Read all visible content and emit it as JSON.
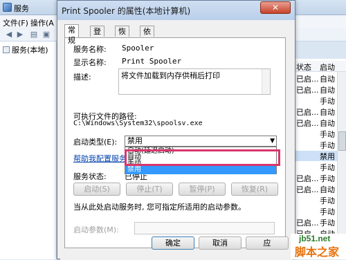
{
  "background_window": {
    "title": "服务",
    "menu": [
      "文件(F)",
      "操作(A"
    ],
    "tree_root": "服务(本地)",
    "list_headers": {
      "status": "状态",
      "startup": "启动"
    },
    "rows": [
      {
        "status": "已启...",
        "startup": "自动",
        "selected": false
      },
      {
        "status": "已启...",
        "startup": "自动",
        "selected": false
      },
      {
        "status": "",
        "startup": "手动",
        "selected": false
      },
      {
        "status": "已启...",
        "startup": "自动",
        "selected": false
      },
      {
        "status": "已启...",
        "startup": "自动",
        "selected": false
      },
      {
        "status": "",
        "startup": "手动",
        "selected": false
      },
      {
        "status": "",
        "startup": "手动",
        "selected": false
      },
      {
        "status": "",
        "startup": "禁用",
        "selected": true
      },
      {
        "status": "",
        "startup": "手动",
        "selected": false
      },
      {
        "status": "已启...",
        "startup": "手动",
        "selected": false
      },
      {
        "status": "已启...",
        "startup": "自动",
        "selected": false
      },
      {
        "status": "",
        "startup": "手动",
        "selected": false
      },
      {
        "status": "",
        "startup": "手动",
        "selected": false
      },
      {
        "status": "已启...",
        "startup": "手动",
        "selected": false
      },
      {
        "status": "已启...",
        "startup": "自动",
        "selected": false
      },
      {
        "status": "",
        "startup": "手动",
        "selected": false
      }
    ]
  },
  "dialog": {
    "title": "Print Spooler 的属性(本地计算机)",
    "close_glyph": "✕",
    "tabs": [
      "常规",
      "登录",
      "恢复",
      "依存关系"
    ],
    "service_name_label": "服务名称:",
    "service_name": "Spooler",
    "display_name_label": "显示名称:",
    "display_name": "Print Spooler",
    "description_label": "描述:",
    "description": "将文件加载到内存供稍后打印",
    "exe_path_label": "可执行文件的路径:",
    "exe_path": "C:\\Windows\\System32\\spoolsv.exe",
    "startup_type_label": "启动类型(E):",
    "startup_type_value": "禁用",
    "startup_options": [
      "自动(延迟启动)",
      "自动",
      "手动",
      "禁用"
    ],
    "highlighted_option": "禁用",
    "help_link": "帮助我配置服务",
    "status_label": "服务状态:",
    "status_value": "已停止",
    "buttons": {
      "start": "启动(S)",
      "stop": "停止(T)",
      "pause": "暂停(P)",
      "resume": "恢复(R)"
    },
    "hint": "当从此处启动服务时, 您可指定所适用的启动参数。",
    "params_label": "启动参数(M):",
    "ok": "确定",
    "cancel": "取消",
    "apply": "应"
  },
  "watermark": {
    "url": "jb51.net",
    "name": "脚本之家"
  }
}
